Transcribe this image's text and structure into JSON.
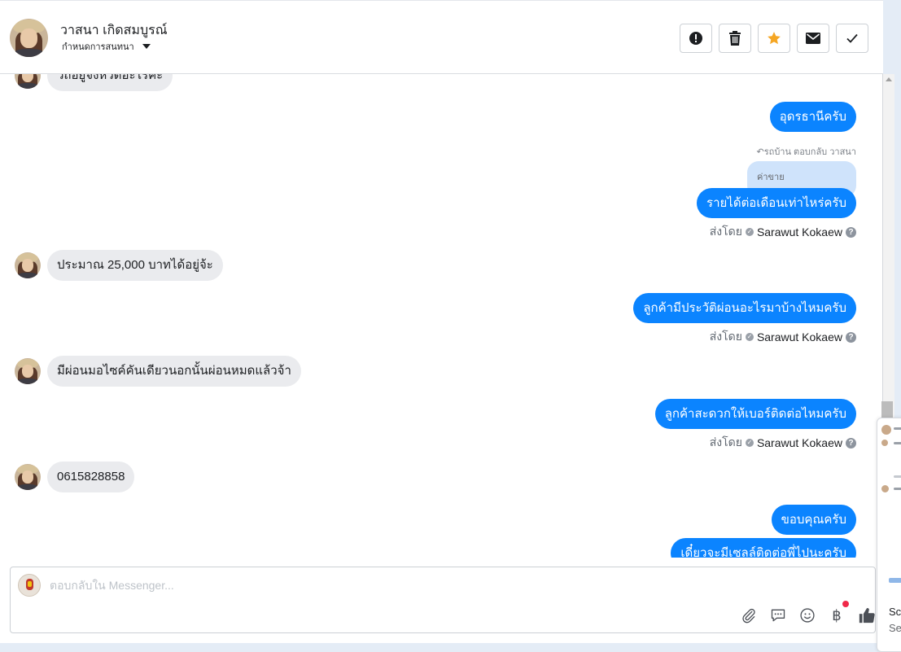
{
  "header": {
    "contact_name": "วาสนา เกิดสมบูรณ์",
    "label_dropdown": "กำหนดการสนทนา",
    "actions": [
      "mark-spam",
      "delete",
      "star",
      "mark-unread",
      "mark-done"
    ]
  },
  "messages": {
    "partial_in": "วถอยูจงหวดอะไรคะ",
    "out_1": "อุดรธานีครับ",
    "reply_meta": "รถบ้าน ตอบกลับ วาสนา",
    "quoted_text": "ค่าขาย",
    "out_2": "รายได้ต่อเดือนเท่าไหร่ครับ",
    "in_1": "ประมาณ 25,000 บาทได้อยู่จ้ะ",
    "out_3": "ลูกค้ามีประวัติผ่อนอะไรมาบ้างไหมครับ",
    "in_2": "มีผ่อนมอไซค์คันเดียวนอกนั้นผ่อนหมดแล้วจ้า",
    "out_4": "ลูกค้าสะดวกให้เบอร์ติดต่อไหมครับ",
    "in_3": "0615828858",
    "out_5": "ขอบคุณครับ",
    "out_6": "เดี๋ยวจะมีเซลล์ติดต่อพี่ไปนะครับ"
  },
  "sent_by": {
    "prefix": "ส่งโดย",
    "agent": "Sarawut Kokaew"
  },
  "composer": {
    "placeholder": "ตอบกลับใน Messenger..."
  },
  "side_preview": {
    "line1": "Sc",
    "line2": "Se"
  },
  "colors": {
    "outgoing_bubble": "#0b84ff",
    "incoming_bubble": "#eaebee",
    "quoted_bubble": "#cfe3fb",
    "star": "#f5a623",
    "notification_dot": "#f02849"
  }
}
